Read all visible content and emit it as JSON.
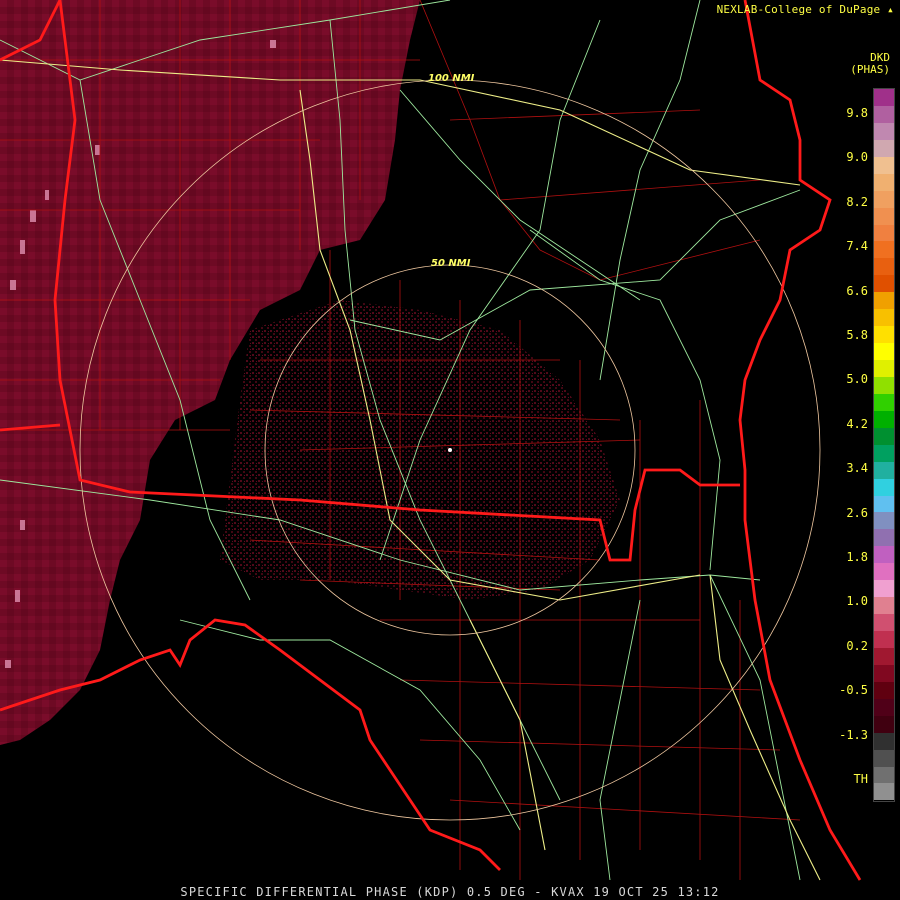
{
  "credit": "NEXLAB-College of DuPage",
  "credit_icon": "nexlab-logo-icon",
  "caption": "SPECIFIC DIFFERENTIAL PHASE (KDP) 0.5 DEG - KVAX 19 OCT 25 13:12",
  "legend": {
    "title_line1": "DKD",
    "title_line2": "(PHAS)",
    "labels": [
      "9.8",
      "9.0",
      "8.2",
      "7.4",
      "6.6",
      "5.8",
      "5.0",
      "4.2",
      "3.4",
      "2.6",
      "1.8",
      "1.0",
      "0.2",
      "-0.5",
      "-1.3",
      "TH"
    ],
    "colors": [
      "#a0308a",
      "#b060a0",
      "#c088b0",
      "#d0a8b0",
      "#f0c090",
      "#f0b070",
      "#f0a060",
      "#f09050",
      "#f08040",
      "#f07020",
      "#e86010",
      "#e05000",
      "#f0a000",
      "#f8c000",
      "#ffe000",
      "#ffff00",
      "#e0f000",
      "#90e000",
      "#30d000",
      "#00b000",
      "#009030",
      "#00a060",
      "#20b0a0",
      "#30d0e0",
      "#60c0f0",
      "#8090c0",
      "#9070b0",
      "#c060c0",
      "#e070c0",
      "#f0a0d0",
      "#e08090",
      "#d05070",
      "#c03050",
      "#a01830",
      "#800820",
      "#600010",
      "#500018",
      "#400010",
      "#303030",
      "#505050",
      "#707070",
      "#909090"
    ]
  },
  "rings": [
    "100 NMI",
    "50 NMI"
  ],
  "colors": {
    "background": "#000000",
    "echo": "#700a25",
    "state_border": "#ff1a1a",
    "county": "#b01010",
    "highway": "#9ee89e",
    "interstate": "#eeee88",
    "range_ring": "#f0c8a0"
  }
}
